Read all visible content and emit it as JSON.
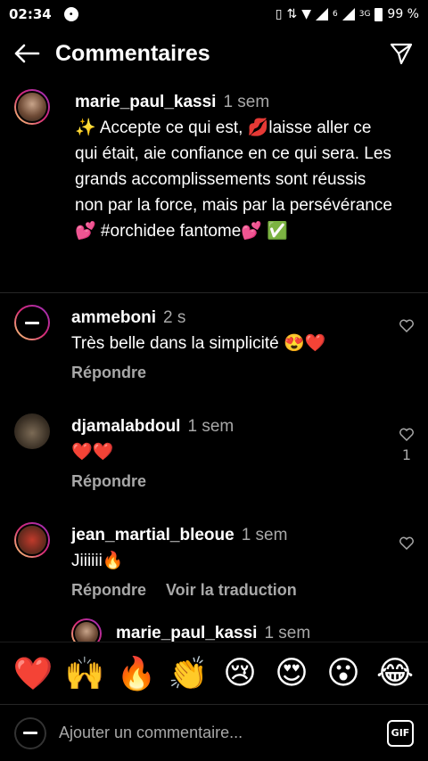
{
  "status": {
    "time": "02:34",
    "battery": "99 %",
    "network": "6",
    "network2": "3G"
  },
  "header": {
    "title": "Commentaires"
  },
  "caption": {
    "username": "marie_paul_kassi",
    "time": "1 sem",
    "text": "✨ Accepte ce qui est, 💋laisse aller ce qui était, aie confiance en ce qui sera. Les grands accomplissements sont réussis non par la force, mais par la persévérance💕 #orchidee fantome💕 ✅"
  },
  "comments": [
    {
      "username": "ammeboni",
      "time": "2 s",
      "text": "Très belle dans la simplicité 😍❤️",
      "reply": "Répondre",
      "likes": ""
    },
    {
      "username": "djamalabdoul",
      "time": "1 sem",
      "text": "❤️❤️",
      "reply": "Répondre",
      "likes": "1"
    },
    {
      "username": "jean_martial_bleoue",
      "time": "1 sem",
      "text": "Jiiiiii🔥",
      "reply": "Répondre",
      "translate": "Voir la traduction",
      "likes": ""
    }
  ],
  "reply_preview": {
    "username": "marie_paul_kassi",
    "time": "1 sem"
  },
  "emoji_bar": [
    "❤️",
    "🙌",
    "🔥",
    "👏",
    "😢",
    "😍",
    "😮",
    "😂"
  ],
  "input": {
    "placeholder": "Ajouter un commentaire...",
    "gif_label": "GIF"
  },
  "icons": {
    "back": "arrow-left-icon",
    "send": "paper-plane-icon",
    "like": "heart-outline-icon"
  },
  "colors": {
    "background": "#000000",
    "muted": "#a8a8a8",
    "divider": "#262626"
  }
}
